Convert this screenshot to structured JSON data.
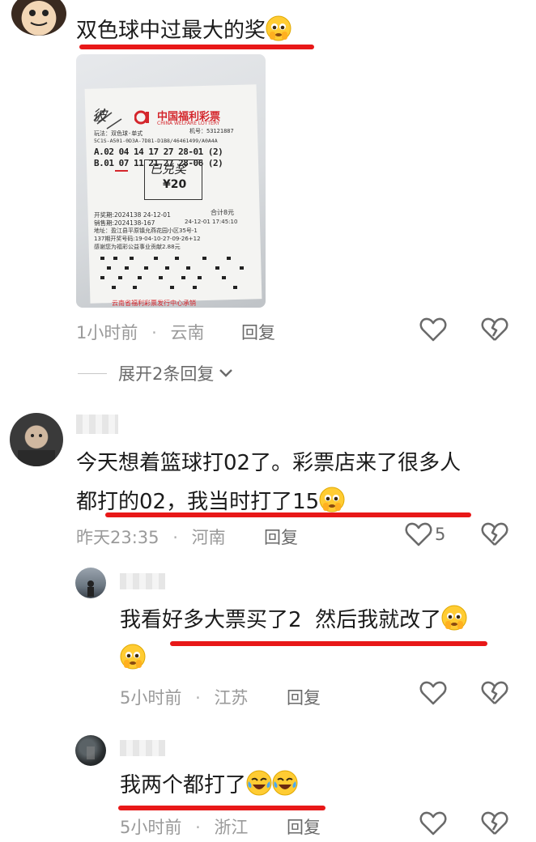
{
  "comments": [
    {
      "text": "双色球中过最大的奖",
      "meta_time": "1小时前",
      "meta_sep": "·",
      "meta_loc": "云南",
      "reply_label": "回复",
      "expand_label": "展开2条回复",
      "ticket": {
        "brand": "中国福利彩票",
        "brand_en": "CHINA WELFARE LOTTERY",
        "line_play": "玩法：双色球-单式",
        "line_machine": "机号：53121887",
        "line_serial": "5C1S-A501-0D3A-7D81-D1B8/46461499/A0A4A",
        "row_a": "A.02 04 14 17 27 28-01 (2)",
        "row_b": "B.01 07 11 21 27 28-06 (2)",
        "stamp": "已兑奖",
        "amount": "¥20",
        "draw_period": "开奖期:2024138 24-12-01",
        "sale_period": "销售期:2024138-167",
        "total": "合计8元",
        "sale_time": "24-12-01 17:45:10",
        "address": "地址：盈江县平原镇允燕花园小区35号-1",
        "open_no": "137期开奖号码:19-04-10-27-09-26+12",
        "thanks": "感谢您为福彩公益事业贡献2.88元",
        "footer": "云南省福利彩票发行中心承销",
        "handwriting": "彼"
      }
    },
    {
      "text_line1": "今天想着篮球打02了。彩票店来了很多人",
      "text_line2": "都打的02，我当时打了15",
      "meta_time": "昨天23:35",
      "meta_sep": "·",
      "meta_loc": "河南",
      "reply_label": "回复",
      "like_count": "5"
    }
  ],
  "replies": [
    {
      "text_line1": "我看好多大票买了2  然后我就改了",
      "meta_time": "5小时前",
      "meta_sep": "·",
      "meta_loc": "江苏",
      "reply_label": "回复"
    },
    {
      "text": "我两个都打了",
      "meta_time": "5小时前",
      "meta_sep": "·",
      "meta_loc": "浙江",
      "reply_label": "回复"
    }
  ],
  "colors": {
    "underline": "#e81818",
    "meta": "#9a9a9a",
    "text": "#1b1b1b",
    "ticket_red": "#d4262c"
  },
  "icons": {
    "like": "heart-outline-icon",
    "dislike": "broken-heart-icon",
    "expand": "chevron-down-icon",
    "emoji_tears": "pleading-face-emoji",
    "emoji_laugh": "tears-of-joy-emoji"
  }
}
